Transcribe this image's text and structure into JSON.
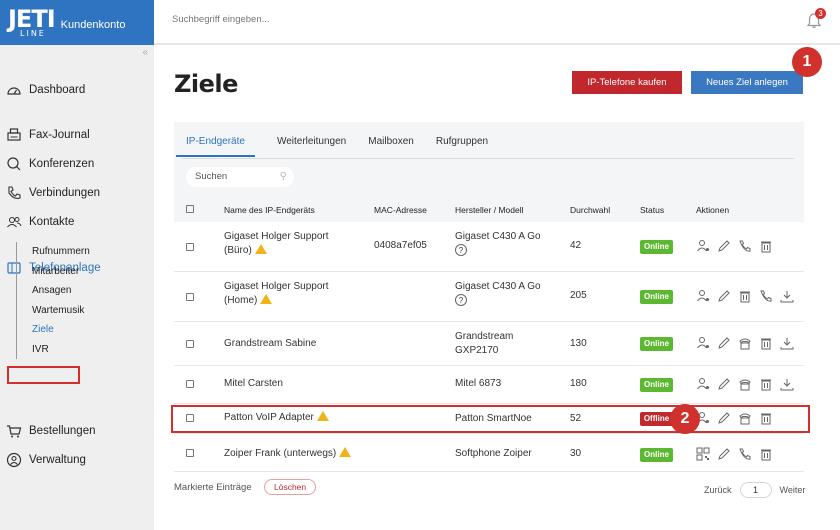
{
  "brand": {
    "logo": "JETI",
    "logo_sub": "LINE",
    "portal": "Kundenkonto"
  },
  "topbar": {
    "search_placeholder": "Suchbegriff eingeben...",
    "notification_count": "3"
  },
  "sidebar": {
    "collapse": "«",
    "items": [
      {
        "label": "Dashboard"
      },
      {
        "label": "Fax-Journal"
      },
      {
        "label": "Konferenzen"
      },
      {
        "label": "Verbindungen"
      },
      {
        "label": "Kontakte"
      },
      {
        "label": "Telefonanlage"
      },
      {
        "label": "Bestellungen"
      },
      {
        "label": "Verwaltung"
      }
    ],
    "subitems": [
      {
        "label": "Rufnummern"
      },
      {
        "label": "Mitarbeiter"
      },
      {
        "label": "Ansagen"
      },
      {
        "label": "Wartemusik"
      },
      {
        "label": "Ziele"
      },
      {
        "label": "IVR"
      }
    ]
  },
  "page": {
    "title": "Ziele",
    "btn_buy": "IP-Telefone kaufen",
    "btn_new": "Neues Ziel anlegen"
  },
  "callouts": [
    "1",
    "2"
  ],
  "tabs": [
    "IP-Endgeräte",
    "Weiterleitungen",
    "Mailboxen",
    "Rufgruppen"
  ],
  "search_placeholder": "Suchen",
  "table": {
    "headers": [
      "Name des IP-Endgeräts",
      "MAC-Adresse",
      "Hersteller / Modell",
      "Durchwahl",
      "Status",
      "Aktionen"
    ],
    "rows": [
      {
        "name1": "Gigaset Holger Support",
        "name2": "(Büro)",
        "mac": "0408a7ef05",
        "model1": "Gigaset C430 A Go",
        "model2": "?",
        "ext": "42",
        "status": "Online"
      },
      {
        "name1": "Gigaset Holger Support",
        "name2": "(Home)",
        "mac": "",
        "model1": "Gigaset C430 A Go",
        "model2": "?",
        "ext": "205",
        "status": "Online"
      },
      {
        "name1": "Grandstream Sabine",
        "name2": "",
        "mac": "",
        "model1": "Grandstream",
        "model2": "GXP2170",
        "ext": "130",
        "status": "Online"
      },
      {
        "name1": "Mitel Carsten",
        "name2": "",
        "mac": "",
        "model1": "Mitel 6873",
        "model2": "",
        "ext": "180",
        "status": "Online"
      },
      {
        "name1": "Patton VoIP Adapter",
        "name2": "",
        "mac": "",
        "model1": "Patton SmartNoe",
        "model2": "",
        "ext": "52",
        "status": "Offline"
      },
      {
        "name1": "Zoiper Frank (unterwegs)",
        "name2": "",
        "mac": "",
        "model1": "Softphone Zoiper",
        "model2": "",
        "ext": "30",
        "status": "Online"
      }
    ]
  },
  "footer": {
    "marked": "Markierte Einträge",
    "delete": "Löschen",
    "back": "Zurück",
    "page": "1",
    "next": "Weiter"
  },
  "colors": {
    "brand_blue": "#2f74c0",
    "danger_red": "#c0282e",
    "online_green": "#5cb831",
    "warn_yellow": "#f0b418"
  }
}
